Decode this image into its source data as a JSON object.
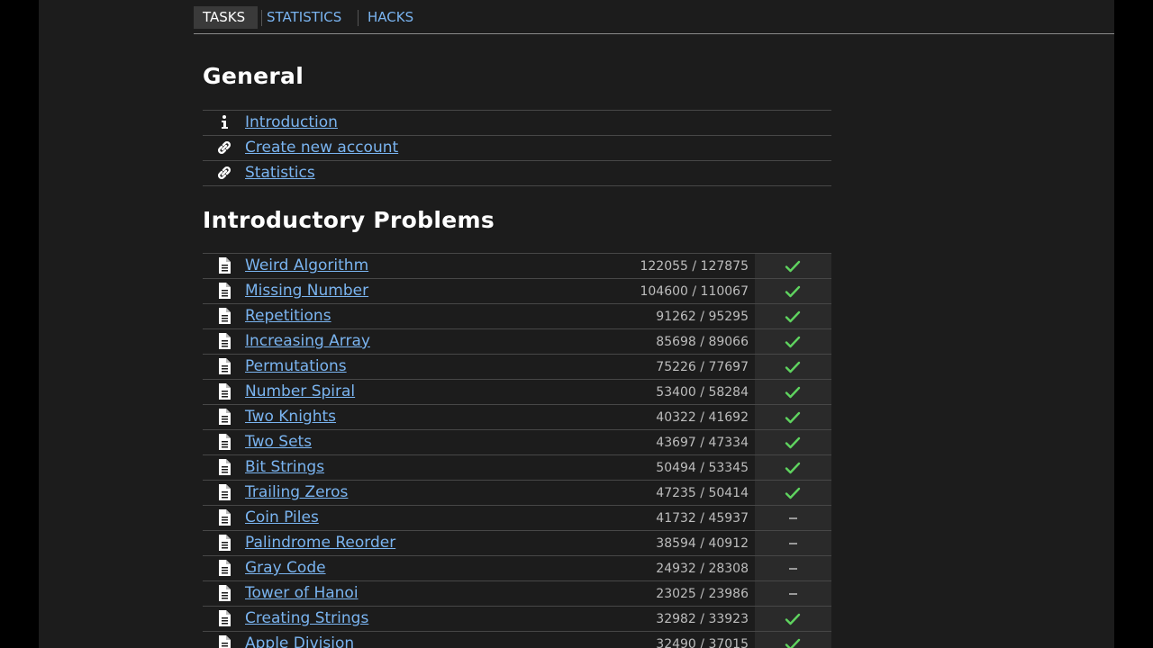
{
  "nav": {
    "tabs": [
      {
        "label": "TASKS",
        "active": true
      },
      {
        "label": "STATISTICS",
        "active": false
      },
      {
        "label": "HACKS",
        "active": false
      }
    ]
  },
  "general": {
    "title": "General",
    "items": [
      {
        "label": "Introduction",
        "icon": "info-icon"
      },
      {
        "label": "Create new account",
        "icon": "link-icon"
      },
      {
        "label": "Statistics",
        "icon": "link-icon"
      }
    ]
  },
  "introductory": {
    "title": "Introductory Problems",
    "problems": [
      {
        "name": "Weird Algorithm",
        "solved": "122055",
        "attempted": "127875",
        "status": "solved"
      },
      {
        "name": "Missing Number",
        "solved": "104600",
        "attempted": "110067",
        "status": "solved"
      },
      {
        "name": "Repetitions",
        "solved": "91262",
        "attempted": "95295",
        "status": "solved"
      },
      {
        "name": "Increasing Array",
        "solved": "85698",
        "attempted": "89066",
        "status": "solved"
      },
      {
        "name": "Permutations",
        "solved": "75226",
        "attempted": "77697",
        "status": "solved"
      },
      {
        "name": "Number Spiral",
        "solved": "53400",
        "attempted": "58284",
        "status": "solved"
      },
      {
        "name": "Two Knights",
        "solved": "40322",
        "attempted": "41692",
        "status": "solved"
      },
      {
        "name": "Two Sets",
        "solved": "43697",
        "attempted": "47334",
        "status": "solved"
      },
      {
        "name": "Bit Strings",
        "solved": "50494",
        "attempted": "53345",
        "status": "solved"
      },
      {
        "name": "Trailing Zeros",
        "solved": "47235",
        "attempted": "50414",
        "status": "solved"
      },
      {
        "name": "Coin Piles",
        "solved": "41732",
        "attempted": "45937",
        "status": "unsolved"
      },
      {
        "name": "Palindrome Reorder",
        "solved": "38594",
        "attempted": "40912",
        "status": "unsolved"
      },
      {
        "name": "Gray Code",
        "solved": "24932",
        "attempted": "28308",
        "status": "unsolved"
      },
      {
        "name": "Tower of Hanoi",
        "solved": "23025",
        "attempted": "23986",
        "status": "unsolved"
      },
      {
        "name": "Creating Strings",
        "solved": "32982",
        "attempted": "33923",
        "status": "solved"
      },
      {
        "name": "Apple Division",
        "solved": "32490",
        "attempted": "37015",
        "status": "solved"
      }
    ]
  },
  "colors": {
    "link": "#7ab4f0",
    "check": "#5fd35f",
    "background": "#1c1c1c"
  }
}
